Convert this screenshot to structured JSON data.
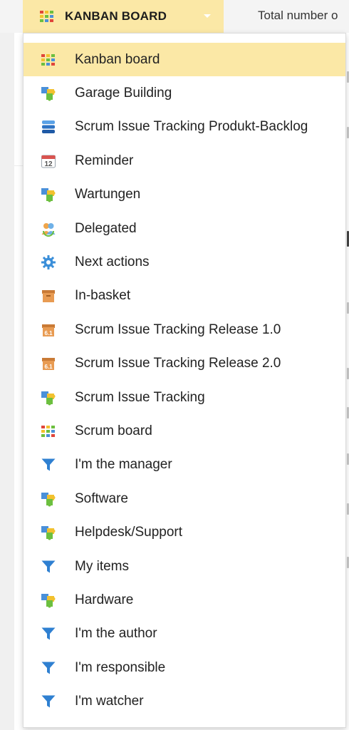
{
  "header": {
    "board_label": "KANBAN BOARD",
    "board_icon": "kanban-grid-icon",
    "total_label": "Total number o"
  },
  "menu": {
    "items": [
      {
        "label": "Kanban board",
        "icon": "kanban-grid",
        "selected": true
      },
      {
        "label": "Garage Building",
        "icon": "puzzle"
      },
      {
        "label": "Scrum Issue Tracking Produkt-Backlog",
        "icon": "stack"
      },
      {
        "label": "Reminder",
        "icon": "calendar"
      },
      {
        "label": "Wartungen",
        "icon": "puzzle"
      },
      {
        "label": "Delegated",
        "icon": "delegate"
      },
      {
        "label": "Next actions",
        "icon": "gear"
      },
      {
        "label": "In-basket",
        "icon": "basket"
      },
      {
        "label": "Scrum Issue Tracking Release 1.0",
        "icon": "release"
      },
      {
        "label": "Scrum Issue Tracking Release 2.0",
        "icon": "release"
      },
      {
        "label": "Scrum Issue Tracking",
        "icon": "puzzle"
      },
      {
        "label": "Scrum board",
        "icon": "kanban-grid"
      },
      {
        "label": "I'm the manager",
        "icon": "filter"
      },
      {
        "label": "Software",
        "icon": "puzzle"
      },
      {
        "label": "Helpdesk/Support",
        "icon": "puzzle"
      },
      {
        "label": "My items",
        "icon": "filter"
      },
      {
        "label": "Hardware",
        "icon": "puzzle"
      },
      {
        "label": "I'm the author",
        "icon": "filter"
      },
      {
        "label": "I'm responsible",
        "icon": "filter"
      },
      {
        "label": "I'm watcher",
        "icon": "filter"
      }
    ]
  },
  "icon_text": {
    "calendar_day": "12",
    "release_version": "6.1"
  },
  "colors": {
    "selected_bg": "#fbe8a6",
    "filter_blue": "#2f80d1",
    "gear_blue": "#3b8fd9",
    "puzzle_blue": "#4a90d9",
    "puzzle_yellow": "#f2c12e",
    "puzzle_green": "#6cbf3f",
    "basket_orange": "#e89b52",
    "stack_blue": "#2d73c4",
    "calendar_red": "#d9534f"
  }
}
